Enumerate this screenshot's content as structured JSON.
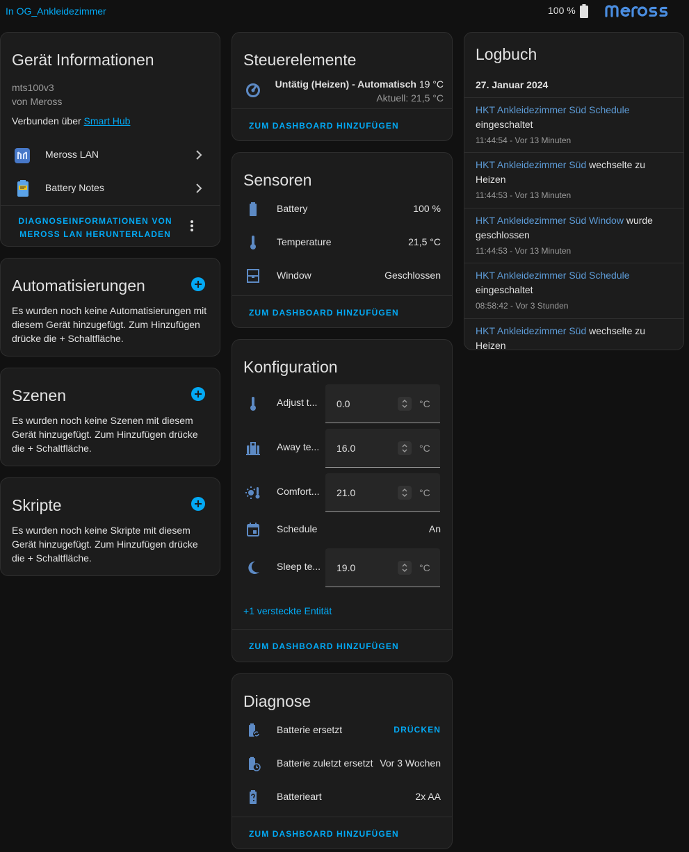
{
  "topbar": {
    "area_link": "In OG_Ankleidezimmer",
    "battery_value": "100 %",
    "brand_logo_alt": "meross"
  },
  "device_info": {
    "title": "Gerät Informationen",
    "model": "mts100v3",
    "manufacturer": "von Meross",
    "connected_prefix": "Verbunden über",
    "connected_link": "Smart Hub",
    "integrations": [
      {
        "label": "Meross LAN",
        "icon": "meross-lan-icon"
      },
      {
        "label": "Battery Notes",
        "icon": "battery-notes-icon"
      }
    ],
    "download_label_line1": "Diagnoseinformationen von",
    "download_label_line2": "Meross LAN herunterladen"
  },
  "automations": {
    "title": "Automatisierungen",
    "text": "Es wurden noch keine Automatisierungen mit diesem Gerät hinzugefügt. Zum Hinzufügen drücke die + Schaltfläche."
  },
  "scenes": {
    "title": "Szenen",
    "text": "Es wurden noch keine Szenen mit diesem Gerät hinzugefügt. Zum Hinzufügen drücke die + Schaltfläche."
  },
  "scripts": {
    "title": "Skripte",
    "text": "Es wurden noch keine Skripte mit diesem Gerät hinzugefügt. Zum Hinzufügen drücke die + Schaltfläche."
  },
  "controls": {
    "title": "Steuerelemente",
    "state_bold": "Untätig (Heizen) - Automatisch",
    "state_target": "19 °C",
    "current": "Aktuell: 21,5 °C",
    "add_label": "Zum Dashboard hinzufügen"
  },
  "sensors": {
    "title": "Sensoren",
    "rows": [
      {
        "label": "Battery",
        "value": "100 %",
        "icon": "battery-icon"
      },
      {
        "label": "Temperature",
        "value": "21,5 °C",
        "icon": "thermometer-icon"
      },
      {
        "label": "Window",
        "value": "Geschlossen",
        "icon": "window-closed-icon"
      }
    ],
    "add_label": "Zum Dashboard hinzufügen"
  },
  "configuration": {
    "title": "Konfiguration",
    "rows": [
      {
        "label": "Adjust t...",
        "value": "0.0",
        "unit": "°C",
        "icon": "thermometer-icon",
        "kind": "number"
      },
      {
        "label": "Away te...",
        "value": "16.0",
        "unit": "°C",
        "icon": "suitcase-icon",
        "kind": "number"
      },
      {
        "label": "Comfort...",
        "value": "21.0",
        "unit": "°C",
        "icon": "sun-thermometer-icon",
        "kind": "number"
      },
      {
        "label": "Schedule",
        "value": "An",
        "icon": "calendar-icon",
        "kind": "text"
      },
      {
        "label": "Sleep te...",
        "value": "19.0",
        "unit": "°C",
        "icon": "moon-icon",
        "kind": "number"
      }
    ],
    "hidden_entities": "+1 versteckte Entität",
    "add_label": "Zum Dashboard hinzufügen"
  },
  "diagnostics": {
    "title": "Diagnose",
    "rows": [
      {
        "label": "Batterie ersetzt",
        "value": "Drücken",
        "icon": "battery-sync-icon"
      },
      {
        "label": "Batterie zuletzt ersetzt",
        "value": "Vor 3 Wochen",
        "icon": "battery-clock-icon"
      },
      {
        "label": "Batterieart",
        "value": "2x AA",
        "icon": "battery-unknown-icon"
      }
    ],
    "add_label": "Zum Dashboard hinzufügen"
  },
  "logbook": {
    "title": "Logbuch",
    "date": "27. Januar 2024",
    "entries": [
      {
        "entity": "HKT Ankleidezimmer Süd Schedule",
        "action": "eingeschaltet",
        "time": "11:44:54 - Vor 13 Minuten"
      },
      {
        "entity": "HKT Ankleidezimmer Süd",
        "action": "wechselte zu Heizen",
        "time": "11:44:53 - Vor 13 Minuten"
      },
      {
        "entity": "HKT Ankleidezimmer Süd Window",
        "action": "wurde geschlossen",
        "time": "11:44:53 - Vor 13 Minuten"
      },
      {
        "entity": "HKT Ankleidezimmer Süd Schedule",
        "action": "eingeschaltet",
        "time": "08:58:42 - Vor 3 Stunden"
      },
      {
        "entity": "HKT Ankleidezimmer Süd",
        "action": "wechselte zu Heizen",
        "time": ""
      }
    ]
  },
  "colors": {
    "accent": "#03a9f4",
    "icon": "#5d8ac4",
    "card": "#1c1c1c",
    "background": "#111111"
  }
}
